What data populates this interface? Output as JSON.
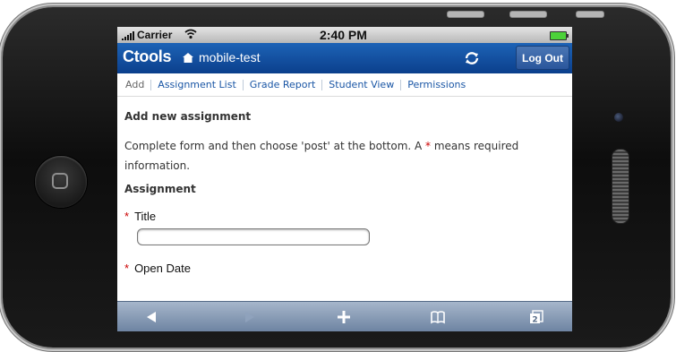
{
  "status": {
    "carrier": "Carrier",
    "time": "2:40 PM"
  },
  "navbar": {
    "brand": "Ctools",
    "site": "mobile-test",
    "logout": "Log Out"
  },
  "tabs": [
    "Add",
    "Assignment List",
    "Grade Report",
    "Student View",
    "Permissions"
  ],
  "content": {
    "heading": "Add new assignment",
    "instructions_before": "Complete form and then choose 'post' at the bottom. A ",
    "required_marker": "*",
    "instructions_after": " means required information.",
    "section": "Assignment",
    "title_label": "Title",
    "title_value": "",
    "open_date_label": "Open Date"
  },
  "icons": {
    "toolbar": [
      "back-arrow-icon",
      "forward-arrow-icon",
      "plus-icon",
      "bookmarks-icon",
      "pages-icon"
    ],
    "pages_count": "2"
  },
  "colors": {
    "navbar": "#0b3f8c",
    "link": "#1a56a5",
    "required": "#cc0000"
  }
}
